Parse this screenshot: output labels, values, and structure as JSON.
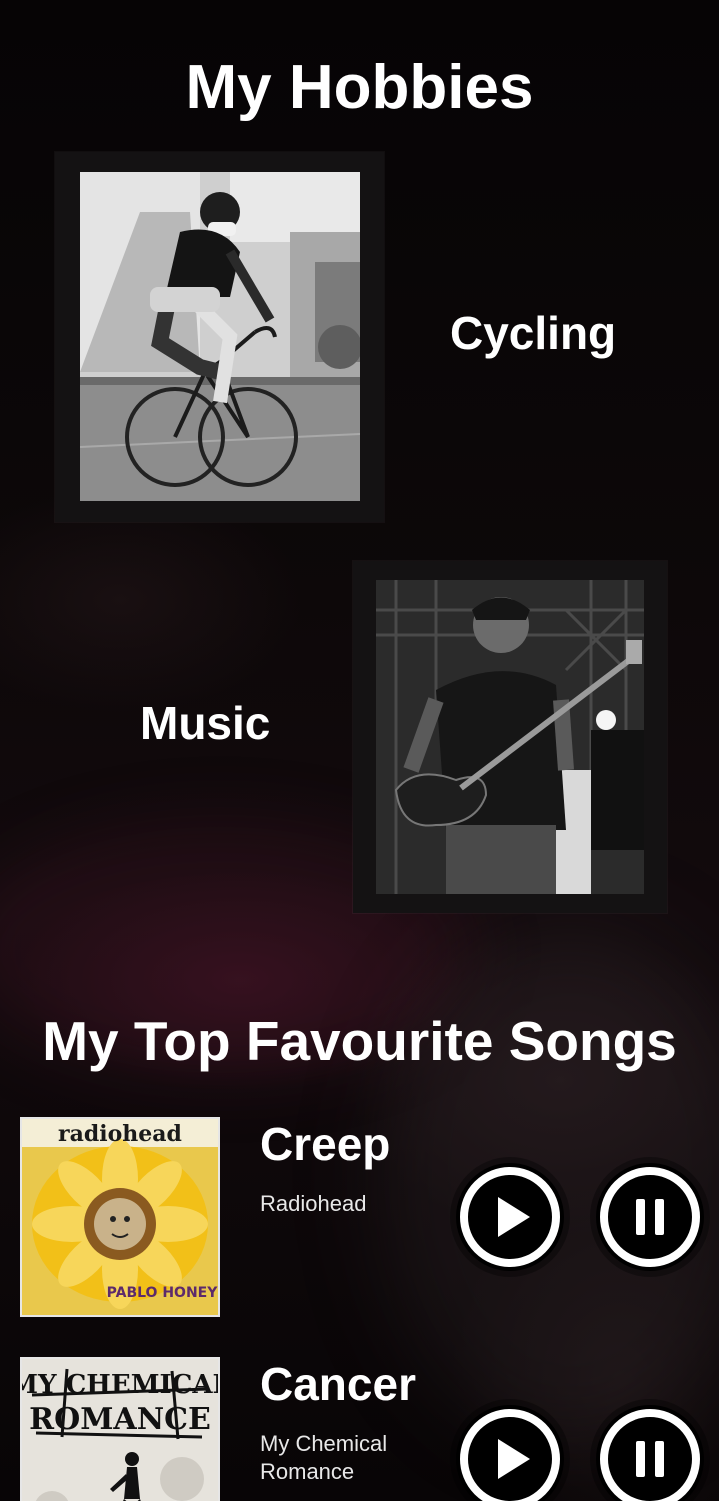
{
  "hobbies": {
    "title": "My Hobbies",
    "items": [
      {
        "label": "Cycling",
        "photo_icon": "cyclist-photo"
      },
      {
        "label": "Music",
        "photo_icon": "bassist-photo"
      }
    ]
  },
  "songs": {
    "title": "My Top Favourite Songs",
    "items": [
      {
        "title": "Creep",
        "artist": "Radiohead",
        "album_art_text_top": "radiohead",
        "album_art_text_bottom": "PABLO HONEY",
        "play_icon": "play-icon",
        "pause_icon": "pause-icon"
      },
      {
        "title": "Cancer",
        "artist": "My Chemical Romance",
        "album_art_text_top": "MY CHEMICAL",
        "album_art_text_bottom": "ROMANCE",
        "play_icon": "play-icon",
        "pause_icon": "pause-icon"
      }
    ]
  },
  "colors": {
    "text": "#ffffff",
    "background": "#0a0607",
    "frame": "#141213",
    "accent_yellow": "#f2c018"
  }
}
